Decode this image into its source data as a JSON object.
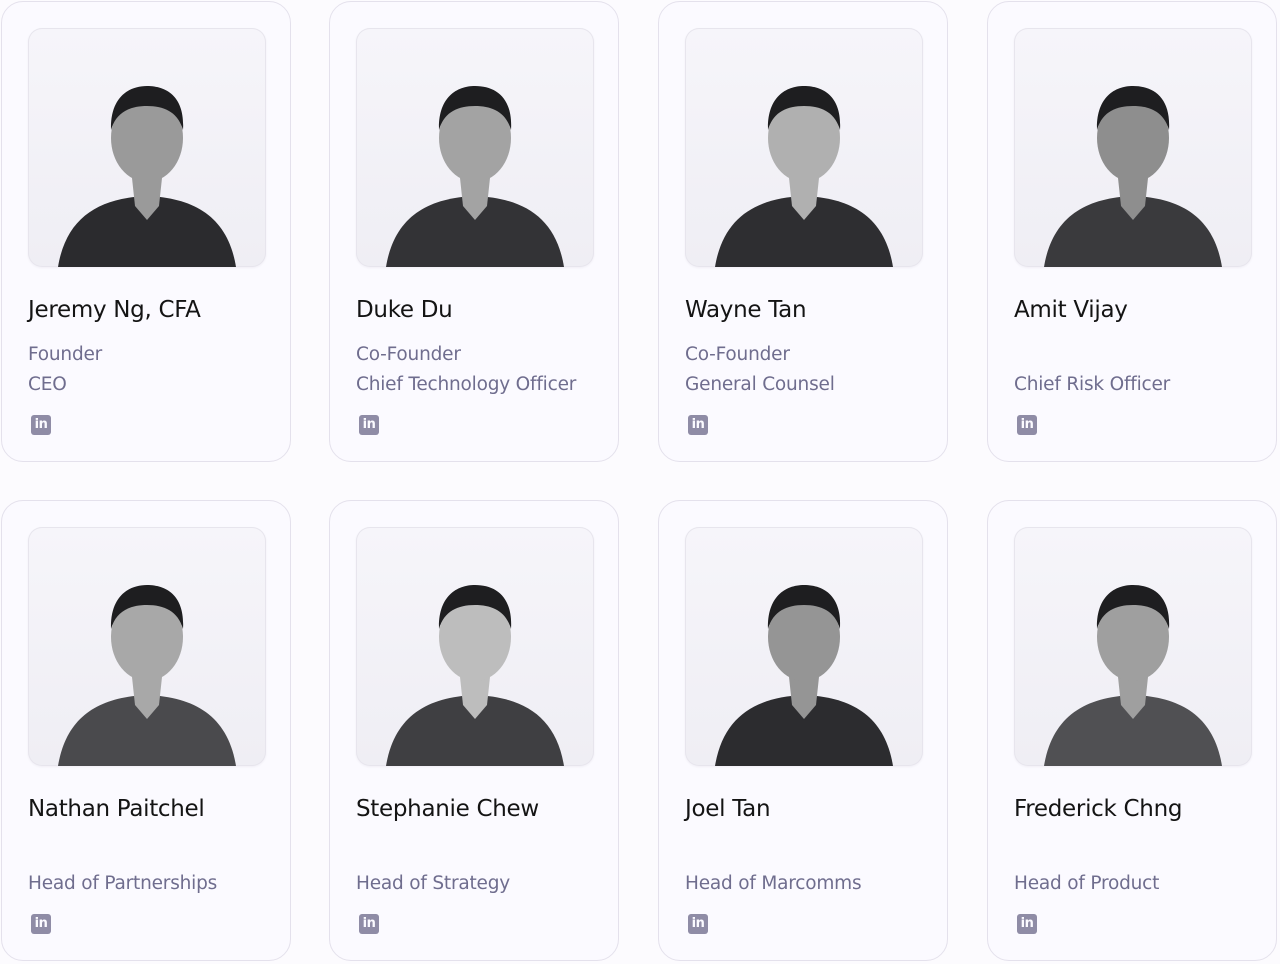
{
  "team": [
    {
      "name": "Jeremy Ng, CFA",
      "role_line1": "Founder",
      "role_line2": "CEO",
      "social_icon": "linkedin-icon"
    },
    {
      "name": "Duke Du",
      "role_line1": "Co-Founder",
      "role_line2": "Chief Technology Officer",
      "social_icon": "linkedin-icon"
    },
    {
      "name": "Wayne Tan",
      "role_line1": "Co-Founder",
      "role_line2": "General Counsel",
      "social_icon": "linkedin-icon"
    },
    {
      "name": "Amit Vijay",
      "role_line1": "",
      "role_line2": "Chief Risk Officer",
      "social_icon": "linkedin-icon"
    },
    {
      "name": "Nathan Paitchel",
      "role_line1": "",
      "role_line2": "Head of Partnerships",
      "social_icon": "linkedin-icon"
    },
    {
      "name": "Stephanie Chew",
      "role_line1": "",
      "role_line2": "Head of Strategy",
      "social_icon": "linkedin-icon"
    },
    {
      "name": "Joel Tan",
      "role_line1": "",
      "role_line2": "Head of Marcomms",
      "social_icon": "linkedin-icon"
    },
    {
      "name": "Frederick Chng",
      "role_line1": "",
      "role_line2": "Head of Product",
      "social_icon": "linkedin-icon"
    }
  ],
  "linkedin_label": "in",
  "colors": {
    "page_background": "#fcfbfe",
    "card_border": "#e4e1ec",
    "name_text": "#141414",
    "role_text": "#6f6d8e",
    "linkedin_icon": "#8f8ca6"
  }
}
